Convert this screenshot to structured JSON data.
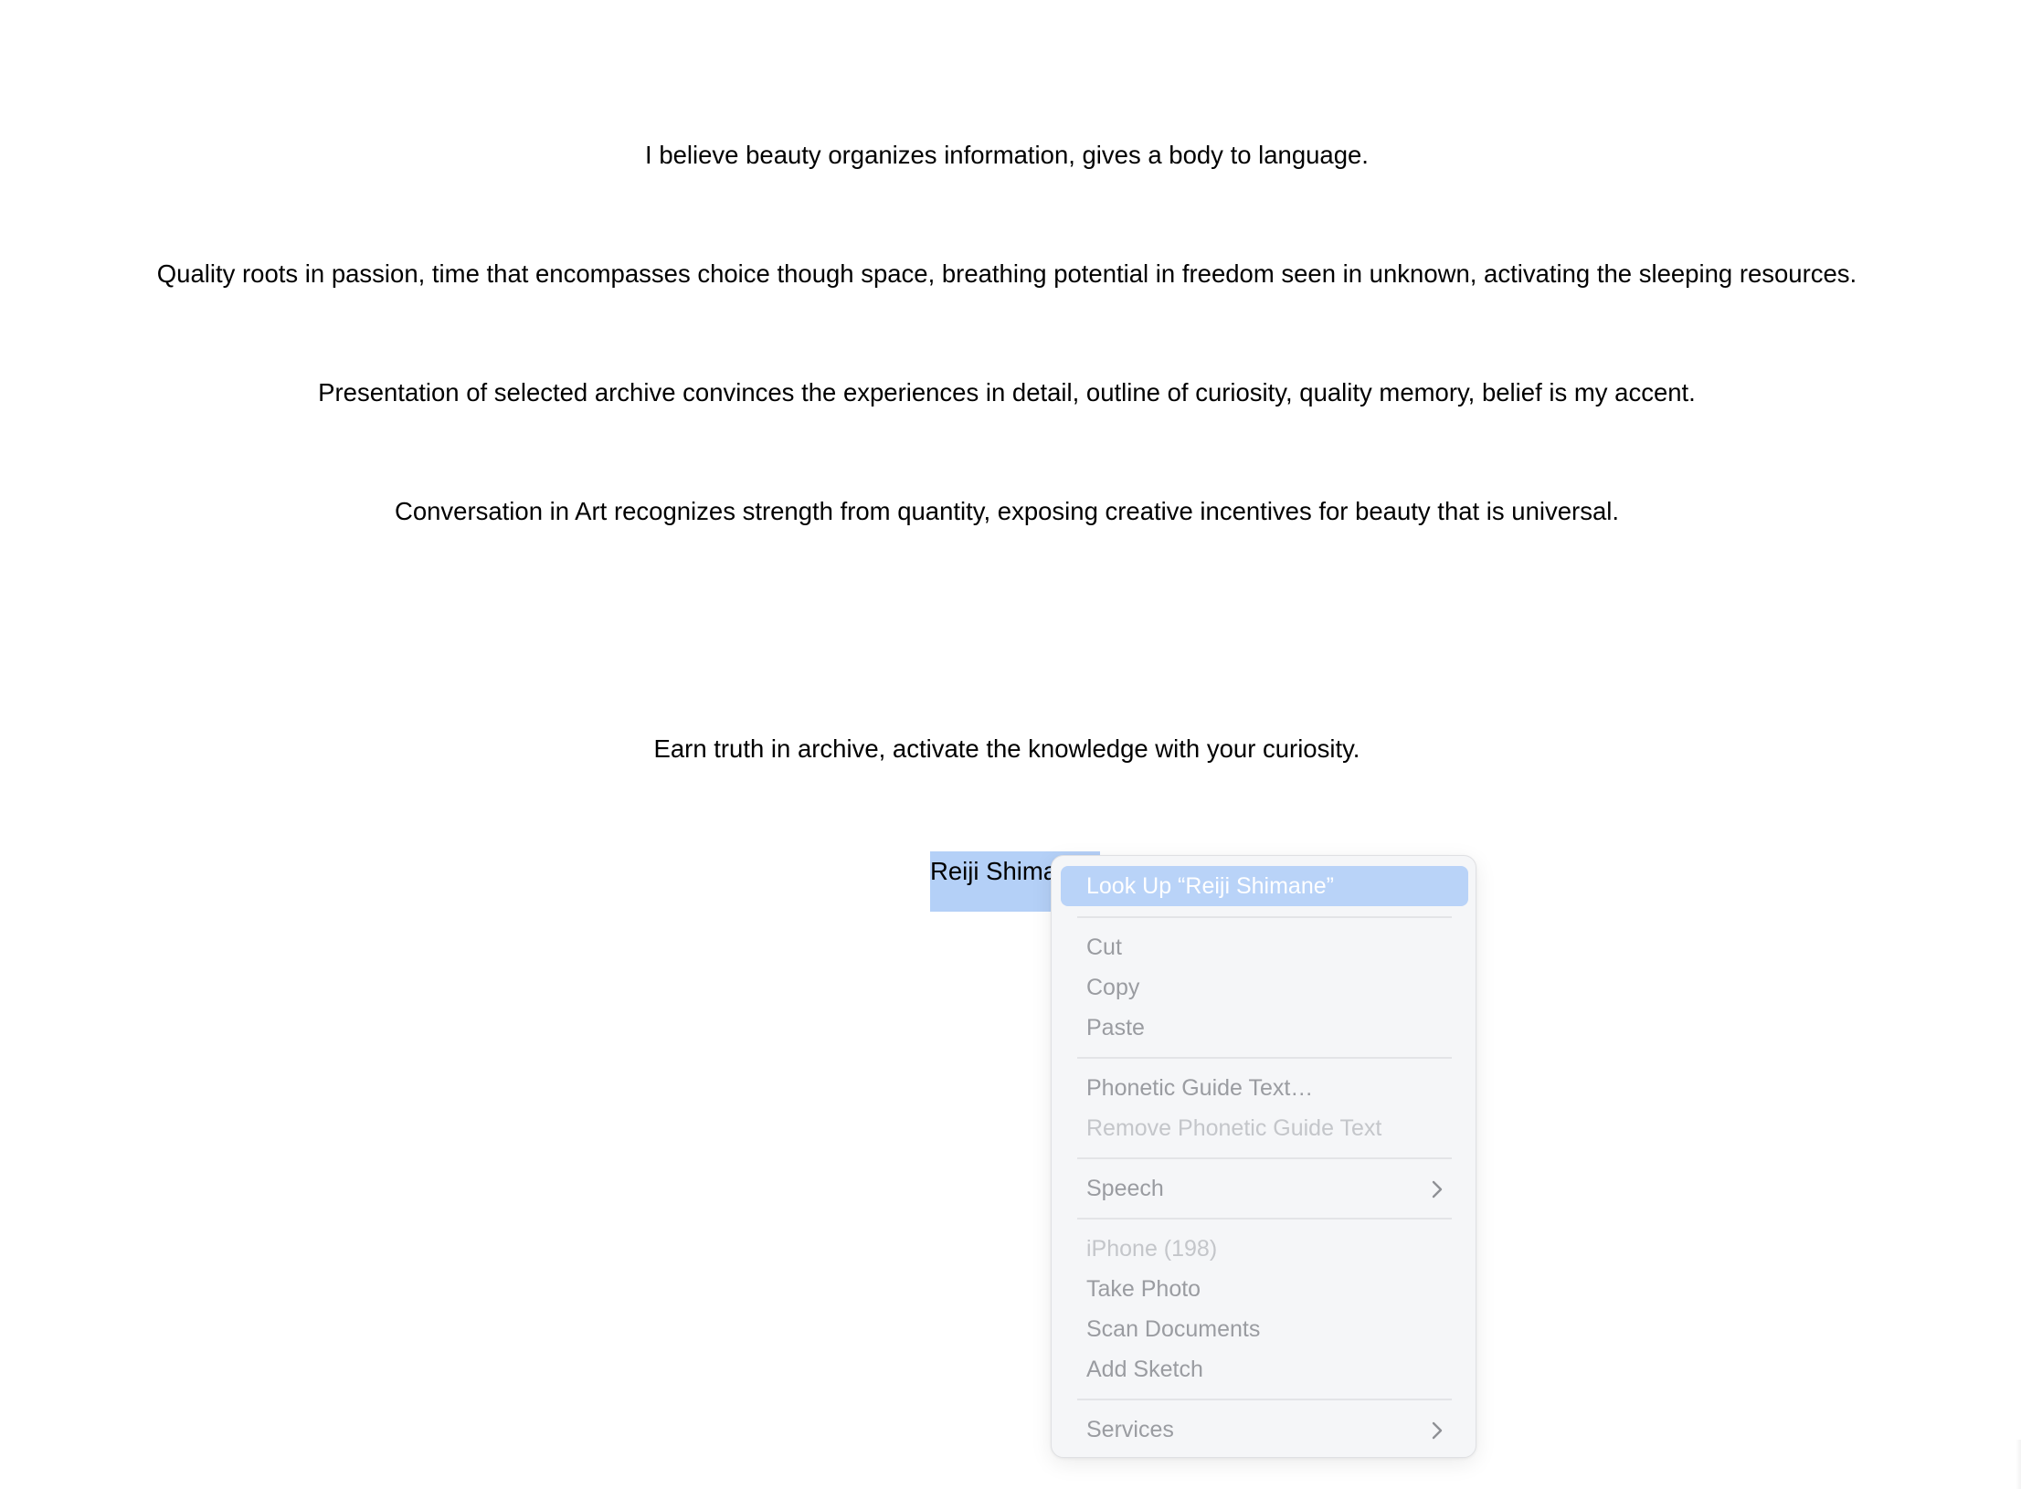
{
  "document": {
    "paragraphs": [
      "I believe beauty organizes information, gives a body to language.",
      "Quality roots in passion, time that encompasses choice though space, breathing potential in freedom seen in unknown, activating the sleeping resources.",
      "Presentation of selected archive convinces the experiences in detail, outline of curiosity, quality memory, belief is my accent.",
      "Conversation in Art recognizes strength from quantity, exposing creative incentives for beauty that is universal.",
      "Earn truth in archive, activate the knowledge with your curiosity."
    ],
    "signature": "Reiji Shimane",
    "pilcrow": "¶"
  },
  "context_menu": {
    "look_up": "Look Up “Reiji Shimane”",
    "cut": "Cut",
    "copy": "Copy",
    "paste": "Paste",
    "phonetic_guide": "Phonetic Guide Text…",
    "remove_phonetic_guide": "Remove Phonetic Guide Text",
    "speech": "Speech",
    "device_header": "iPhone (198)",
    "take_photo": "Take Photo",
    "scan_documents": "Scan Documents",
    "add_sketch": "Add Sketch",
    "services": "Services"
  },
  "colors": {
    "selection": "#b4d0f7",
    "menu_highlight": "#b9d3f8",
    "menu_background": "#f5f6f8",
    "menu_text": "#9a9ca1",
    "menu_text_disabled": "#c4c6ca",
    "pilcrow": "#3b82f6"
  },
  "icons": {
    "submenu_chevron": "chevron-right-icon"
  }
}
